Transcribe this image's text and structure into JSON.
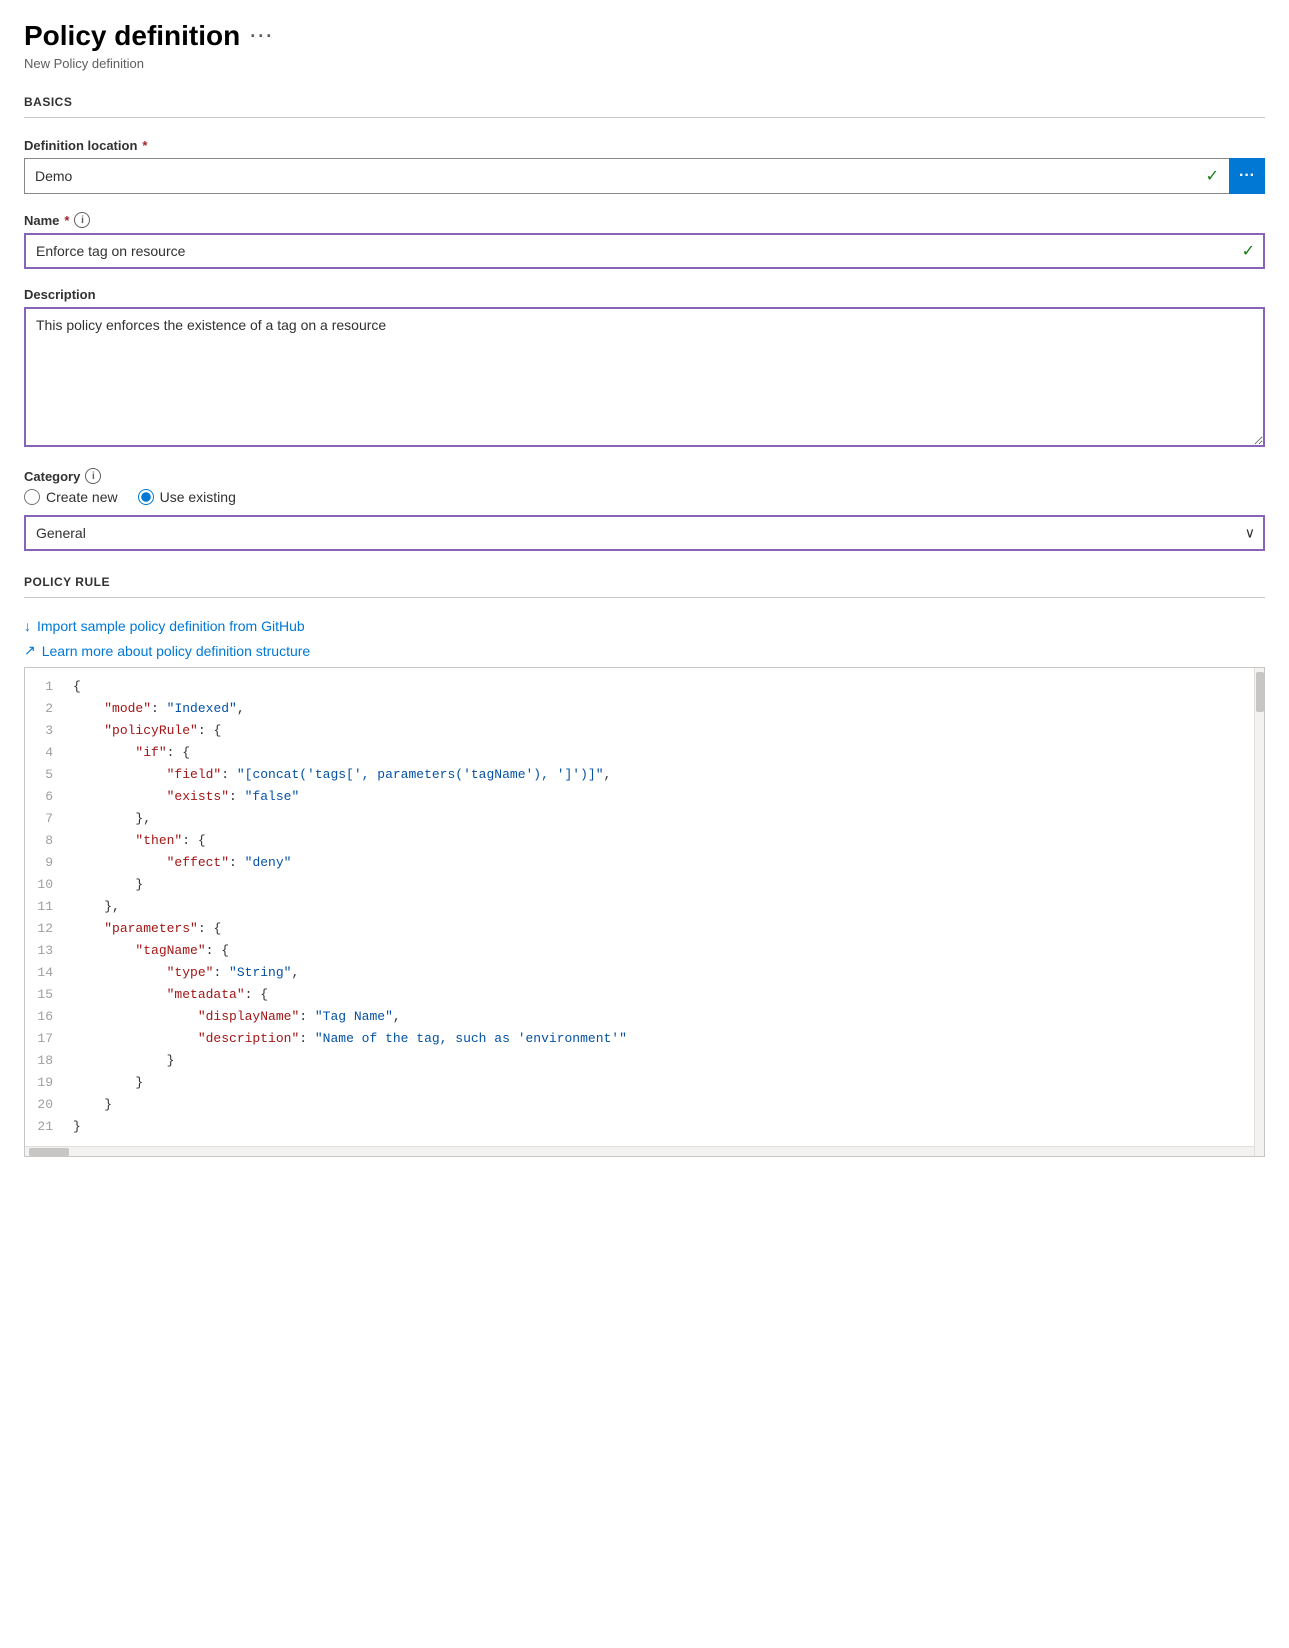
{
  "header": {
    "title": "Policy definition",
    "ellipsis": "···",
    "subtitle": "New Policy definition"
  },
  "sections": {
    "basics": "BASICS",
    "policyRule": "POLICY RULE"
  },
  "fields": {
    "definitionLocation": {
      "label": "Definition location",
      "required": true,
      "value": "Demo",
      "btnLabel": "···"
    },
    "name": {
      "label": "Name",
      "required": true,
      "value": "Enforce tag on resource"
    },
    "description": {
      "label": "Description",
      "value": "This policy enforces the existence of a tag on a resource"
    },
    "category": {
      "label": "Category",
      "options": [
        {
          "id": "create-new",
          "label": "Create new",
          "selected": false
        },
        {
          "id": "use-existing",
          "label": "Use existing",
          "selected": true
        }
      ],
      "selectValue": "General"
    }
  },
  "links": {
    "importGithub": "Import sample policy definition from GitHub",
    "learnMore": "Learn more about policy definition structure"
  },
  "codeLines": [
    {
      "num": 1,
      "content": "{"
    },
    {
      "num": 2,
      "content": "    \"mode\": \"Indexed\","
    },
    {
      "num": 3,
      "content": "    \"policyRule\": {"
    },
    {
      "num": 4,
      "content": "        \"if\": {"
    },
    {
      "num": 5,
      "content": "            \"field\": \"[concat('tags[', parameters('tagName'), ']')]\","
    },
    {
      "num": 6,
      "content": "            \"exists\": \"false\""
    },
    {
      "num": 7,
      "content": "        },"
    },
    {
      "num": 8,
      "content": "        \"then\": {"
    },
    {
      "num": 9,
      "content": "            \"effect\": \"deny\""
    },
    {
      "num": 10,
      "content": "        }"
    },
    {
      "num": 11,
      "content": "    },"
    },
    {
      "num": 12,
      "content": "    \"parameters\": {"
    },
    {
      "num": 13,
      "content": "        \"tagName\": {"
    },
    {
      "num": 14,
      "content": "            \"type\": \"String\","
    },
    {
      "num": 15,
      "content": "            \"metadata\": {"
    },
    {
      "num": 16,
      "content": "                \"displayName\": \"Tag Name\","
    },
    {
      "num": 17,
      "content": "                \"description\": \"Name of the tag, such as 'environment'\""
    },
    {
      "num": 18,
      "content": "            }"
    },
    {
      "num": 19,
      "content": "        }"
    },
    {
      "num": 20,
      "content": "    }"
    },
    {
      "num": 21,
      "content": "}"
    }
  ]
}
